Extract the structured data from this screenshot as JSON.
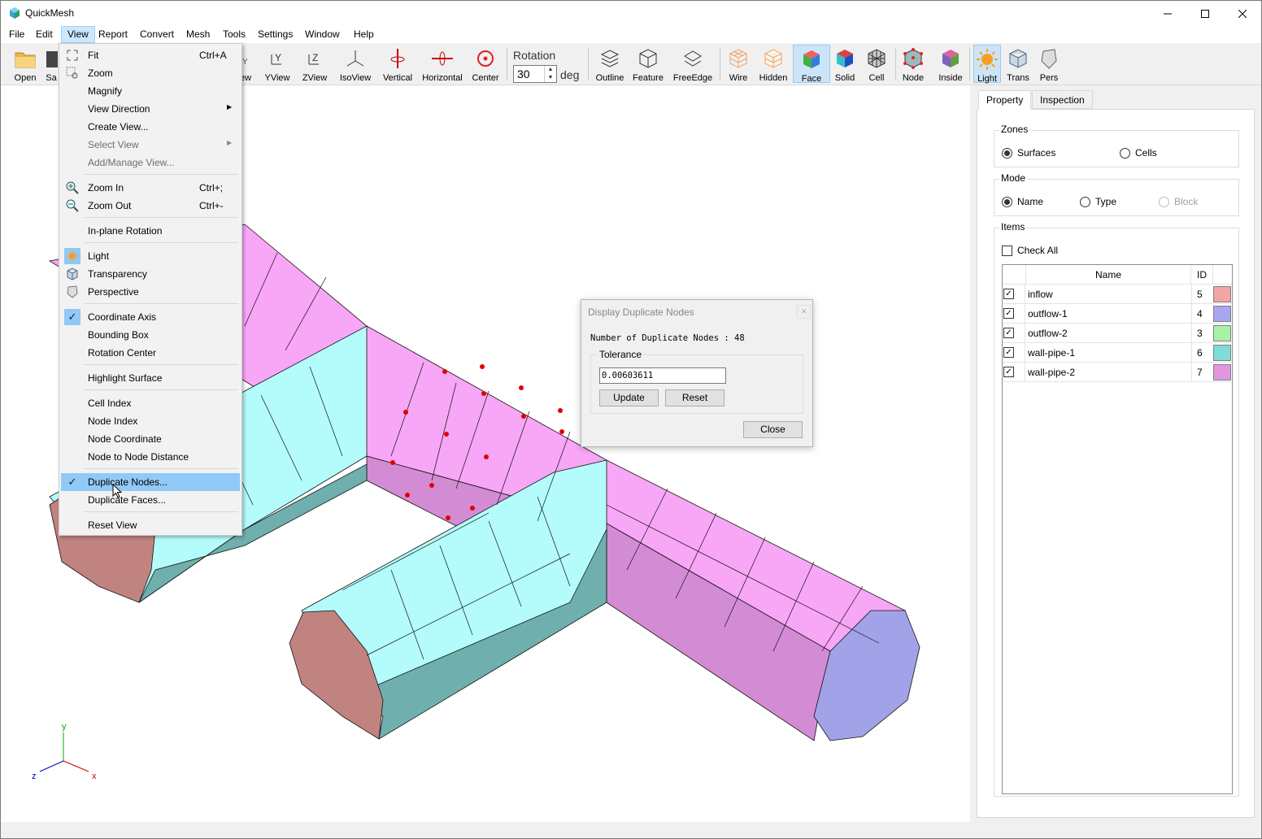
{
  "app": {
    "title": "QuickMesh"
  },
  "menubar": [
    "File",
    "Edit",
    "View",
    "Report",
    "Convert",
    "Mesh",
    "Tools",
    "Settings",
    "Window",
    "Help"
  ],
  "toolbar": {
    "open": "Open",
    "save": "Sa",
    "xview": "ew",
    "yview": "YView",
    "zview": "ZView",
    "isoview": "IsoView",
    "vertical": "Vertical",
    "horizontal": "Horizontal",
    "center": "Center",
    "rotation_label": "Rotation",
    "rotation_value": "30",
    "rotation_unit": "deg",
    "outline": "Outline",
    "feature": "Feature",
    "freeedge": "FreeEdge",
    "wire": "Wire",
    "hidden": "Hidden",
    "face": "Face",
    "solid": "Solid",
    "cell": "Cell",
    "node": "Node",
    "inside": "Inside",
    "light": "Light",
    "trans": "Trans",
    "pers": "Pers"
  },
  "view_menu": {
    "fit": "Fit",
    "fit_shortcut": "Ctrl+A",
    "zoom": "Zoom",
    "magnify": "Magnify",
    "view_direction": "View Direction",
    "create_view": "Create View...",
    "select_view": "Select View",
    "add_manage_view": "Add/Manage View...",
    "zoom_in": "Zoom In",
    "zoom_in_shortcut": "Ctrl+;",
    "zoom_out": "Zoom Out",
    "zoom_out_shortcut": "Ctrl+-",
    "inplane_rotation": "In-plane Rotation",
    "light": "Light",
    "transparency": "Transparency",
    "perspective": "Perspective",
    "coordinate_axis": "Coordinate Axis",
    "bounding_box": "Bounding Box",
    "rotation_center": "Rotation Center",
    "highlight_surface": "Highlight Surface",
    "cell_index": "Cell Index",
    "node_index": "Node Index",
    "node_coordinate": "Node Coordinate",
    "node_to_node": "Node to Node Distance",
    "duplicate_nodes": "Duplicate Nodes...",
    "duplicate_faces": "Duplicate Faces...",
    "reset_view": "Reset View"
  },
  "dialog": {
    "title": "Display Duplicate Nodes",
    "count_text": "Number of Duplicate Nodes : 48",
    "tolerance_label": "Tolerance",
    "tolerance_value": "0.00603611",
    "update": "Update",
    "reset": "Reset",
    "close": "Close"
  },
  "panel": {
    "tabs": [
      "Property",
      "Inspection"
    ],
    "zones_label": "Zones",
    "zones_surfaces": "Surfaces",
    "zones_cells": "Cells",
    "mode_label": "Mode",
    "mode_name": "Name",
    "mode_type": "Type",
    "mode_block": "Block",
    "items_label": "Items",
    "check_all": "Check All",
    "col_name": "Name",
    "col_id": "ID",
    "items": [
      {
        "name": "inflow",
        "id": "5",
        "color": "#f4a4a4"
      },
      {
        "name": "outflow-1",
        "id": "4",
        "color": "#a6a6f2"
      },
      {
        "name": "outflow-2",
        "id": "3",
        "color": "#a6f2a6"
      },
      {
        "name": "wall-pipe-1",
        "id": "6",
        "color": "#80dcd8"
      },
      {
        "name": "wall-pipe-2",
        "id": "7",
        "color": "#e296e0"
      }
    ]
  },
  "axis": {
    "x": "x",
    "y": "y",
    "z": "z"
  },
  "colors": {
    "pink_top": "#f8a6f6",
    "pink_side": "#d38cd4",
    "cyan_top": "#b4fcfc",
    "cyan_side": "#6fb0ae",
    "brown": "#c18380",
    "blue_cap": "#a2a2e8",
    "accent": "#0078d7"
  }
}
